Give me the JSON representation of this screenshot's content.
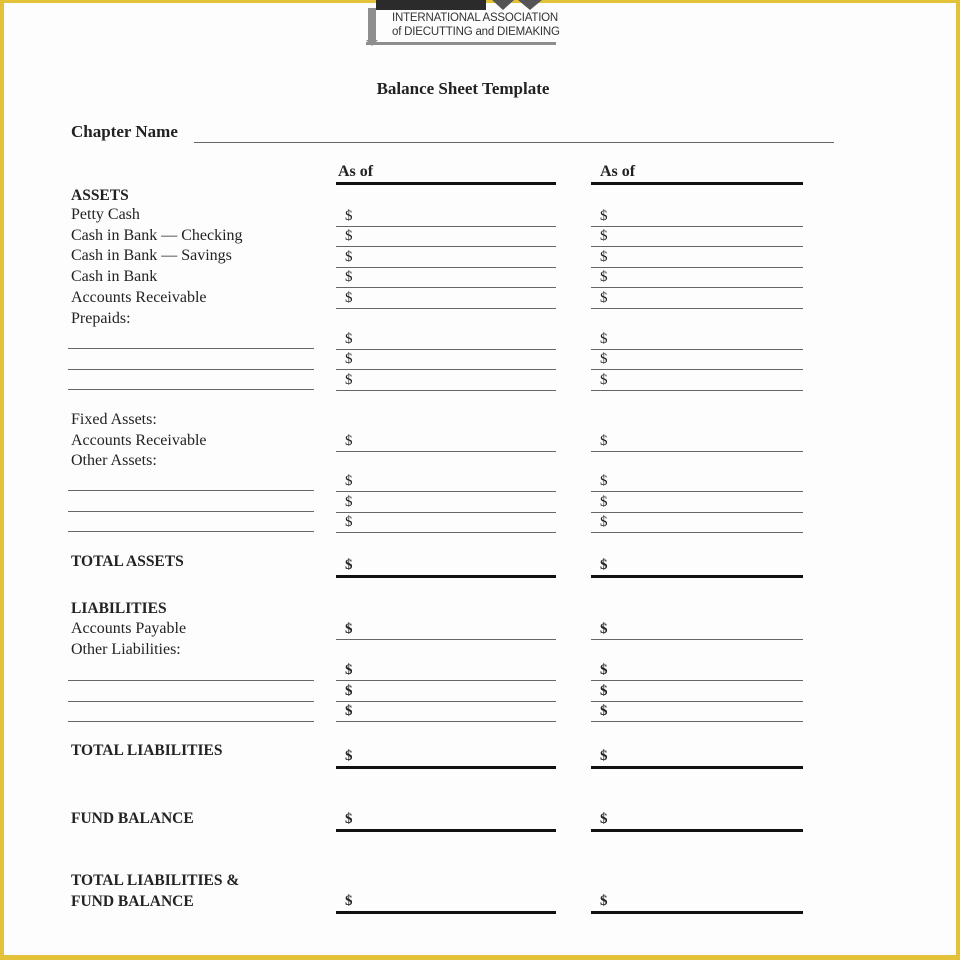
{
  "logo": {
    "line1": "INTERNATIONAL  ASSOCIATION",
    "line2": "of DIECUTTING and DIEMAKING",
    "brand_color": "#e3c23a"
  },
  "document": {
    "title": "Balance Sheet Template",
    "chapter_label": "Chapter Name",
    "columns": [
      "As of",
      "As of"
    ],
    "currency_symbol": "$"
  },
  "rows": {
    "assets_heading": "ASSETS",
    "petty_cash": "Petty Cash",
    "cash_checking": "Cash in Bank — Checking",
    "cash_savings": "Cash in Bank — Savings",
    "cash_bank": "Cash in Bank",
    "accounts_receivable": "Accounts Receivable",
    "prepaids": "Prepaids:",
    "fixed_assets": "Fixed Assets:",
    "fixed_accounts_receivable": "Accounts Receivable",
    "other_assets": "Other Assets:",
    "total_assets": "TOTAL ASSETS",
    "liabilities_heading": "LIABILITIES",
    "accounts_payable": "Accounts Payable",
    "other_liabilities": "Other Liabilities:",
    "total_liabilities": "TOTAL LIABILITIES",
    "fund_balance": "FUND BALANCE",
    "total_liab_fund_1": "TOTAL LIABILITIES &",
    "total_liab_fund_2": "FUND BALANCE"
  }
}
